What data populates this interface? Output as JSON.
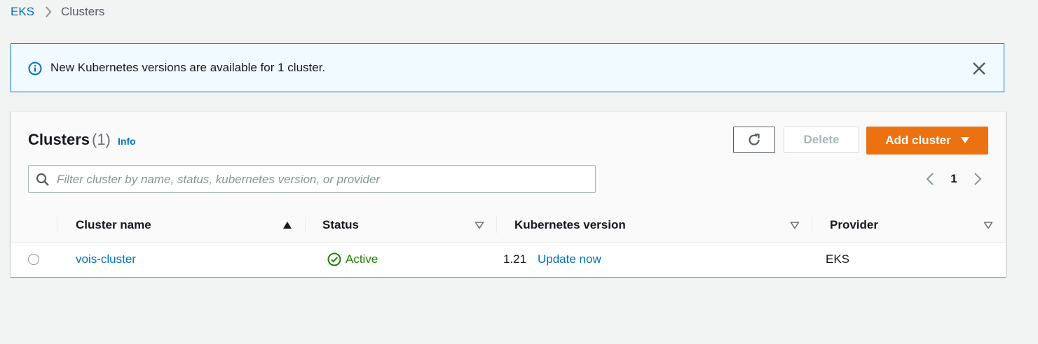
{
  "breadcrumb": {
    "root": "EKS",
    "current": "Clusters"
  },
  "flash": {
    "message": "New Kubernetes versions are available for 1 cluster.",
    "icon": "info-icon"
  },
  "panel": {
    "title": "Clusters",
    "count": "(1)",
    "info_label": "Info",
    "delete_label": "Delete",
    "add_label": "Add cluster",
    "search_placeholder": "Filter cluster by name, status, kubernetes version, or provider",
    "search_value": "",
    "page_number": "1"
  },
  "table": {
    "columns": [
      {
        "label": "Cluster name",
        "sort": "ascending"
      },
      {
        "label": "Status",
        "sort": "none"
      },
      {
        "label": "Kubernetes version",
        "sort": "none"
      },
      {
        "label": "Provider",
        "sort": "none"
      }
    ],
    "rows": [
      {
        "name": "vois-cluster",
        "status": "Active",
        "version": "1.21",
        "version_action": "Update now",
        "provider": "EKS"
      }
    ]
  },
  "colors": {
    "link": "#0073bb",
    "primary_button": "#ec7211",
    "success": "#1d8102",
    "info_border": "#0073bb"
  }
}
